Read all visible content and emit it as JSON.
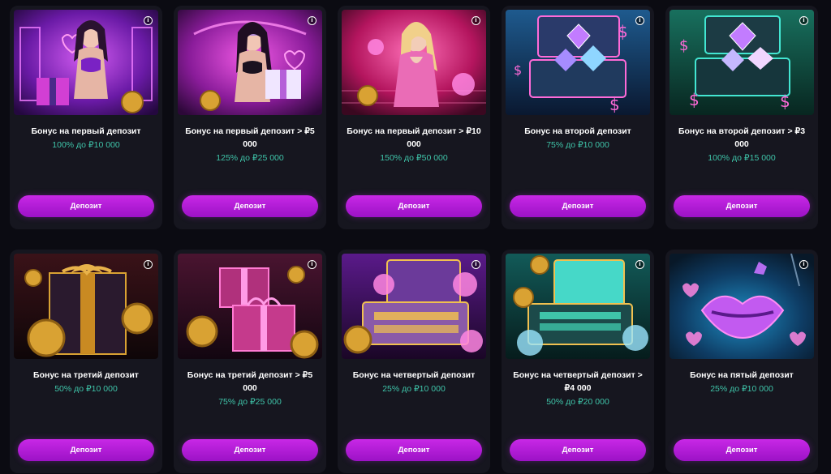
{
  "ui": {
    "accent_color": "#b21ad8",
    "bonus_text_color": "#3fc4a9",
    "card_background": "#16161f",
    "page_background": "#0b0b12",
    "info_icon": "info-icon",
    "info_glyph": "i"
  },
  "cards": [
    {
      "title": "Бонус на первый депозит",
      "bonus": "100% до ₽10 000",
      "button_label": "Депозит",
      "art": "woman-purple-gift"
    },
    {
      "title": "Бонус на первый депозит > ₽5 000",
      "bonus": "125% до ₽25 000",
      "button_label": "Депозит",
      "art": "woman-mask-gift"
    },
    {
      "title": "Бонус на первый депозит > ₽10 000",
      "bonus": "150% до ₽50 000",
      "button_label": "Депозит",
      "art": "woman-pink-coins"
    },
    {
      "title": "Бонус на второй депозит",
      "bonus": "75% до ₽10 000",
      "button_label": "Депозит",
      "art": "blue-chest-crystal"
    },
    {
      "title": "Бонус на второй депозит > ₽3 000",
      "bonus": "100% до ₽15 000",
      "button_label": "Депозит",
      "art": "teal-chest-crystal"
    },
    {
      "title": "Бонус на третий депозит",
      "bonus": "50% до ₽10 000",
      "button_label": "Депозит",
      "art": "gold-gift-coins"
    },
    {
      "title": "Бонус на третий депозит > ₽5 000",
      "bonus": "75% до ₽25 000",
      "button_label": "Депозит",
      "art": "pink-gifts-coins"
    },
    {
      "title": "Бонус на четвертый депозит",
      "bonus": "25% до ₽10 000",
      "button_label": "Депозит",
      "art": "gold-case-coins"
    },
    {
      "title": "Бонус на четвертый депозит > ₽4 000",
      "bonus": "50% до ₽20 000",
      "button_label": "Депозит",
      "art": "teal-case-coins"
    },
    {
      "title": "Бонус на пятый депозит",
      "bonus": "25% до ₽10 000",
      "button_label": "Депозит",
      "art": "neon-lips-hearts"
    }
  ]
}
